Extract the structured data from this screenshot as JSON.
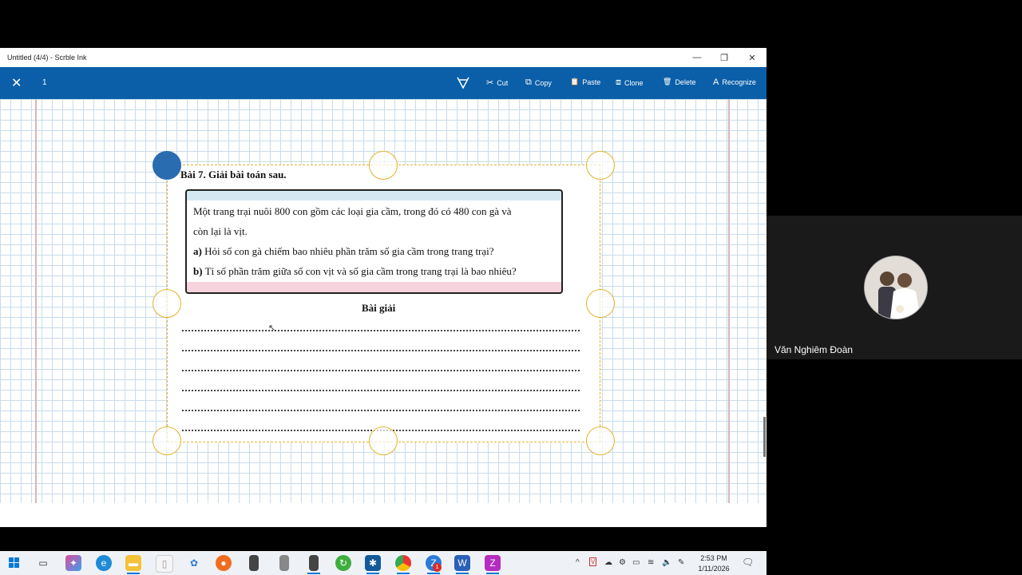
{
  "window": {
    "title": "Untitled (4/4) - Scrble Ink",
    "controls": {
      "minimize": "—",
      "restore": "❐",
      "close": "✕"
    }
  },
  "toolbar": {
    "close_icon": "✕",
    "selection_count": "1",
    "lasso_icon": "lasso-icon",
    "buttons": [
      {
        "label": "Cut",
        "icon": "✂"
      },
      {
        "label": "Copy",
        "icon": "⧉"
      },
      {
        "label": "Paste",
        "icon": "📋"
      },
      {
        "label": "Clone",
        "icon": "⧈"
      },
      {
        "label": "Delete",
        "icon": "🗑"
      },
      {
        "label": "Recognize",
        "icon": "A"
      }
    ]
  },
  "document": {
    "heading": "Bài 7. Giải bài toán sau.",
    "problem": {
      "line1": "Một trang trại nuôi 800 con gồm các loại gia cầm, trong đó có 480 con gà và",
      "line2": "còn lại là vịt.",
      "line3_marker": "a)",
      "line3": " Hỏi số con gà chiếm bao nhiêu phần trăm số gia cầm trong trang trại?",
      "line4_marker": "b)",
      "line4": " Tỉ số phần trăm giữa số con vịt và số gia cầm trong trang trại là bao nhiêu?"
    },
    "solution_heading": "Bài giải",
    "answer_lines": 6
  },
  "taskbar": {
    "clock_time": "2:53 PM",
    "clock_date": "1/11/2026",
    "notification_badge": "1",
    "colors": {
      "accent": "#0a5fa8",
      "selection": "#e2b52c"
    }
  },
  "participant": {
    "name": "Văn Nghiêm Đoàn"
  }
}
